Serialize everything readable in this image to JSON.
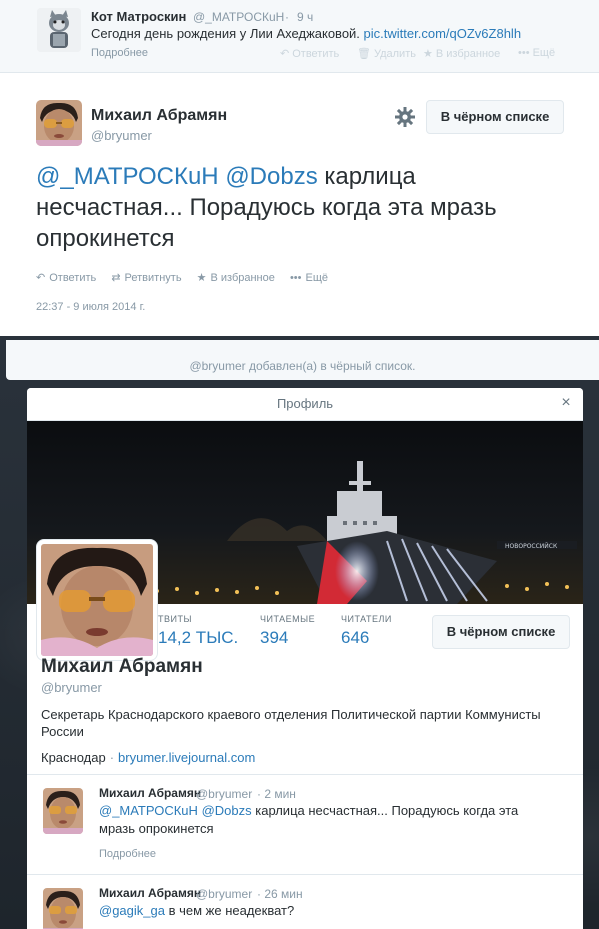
{
  "top_tweet": {
    "name": "Кот Матроскин",
    "handle": "@_МАТРОСКuН",
    "separator": "·",
    "time": "9 ч",
    "text": "Сегодня день рождения у Лии Ахеджаковой.",
    "link": "pic.twitter.com/qOZv6Z8hlh",
    "more": "Подробнее",
    "actions": {
      "reply": "Ответить",
      "delete": "Удалить",
      "favorite": "В избранное",
      "more": "Ещё"
    }
  },
  "main_tweet": {
    "name": "Михаил Абрамян",
    "handle": "@bryumer",
    "blocked_button": "В чёрном списке",
    "mention1": "@_МАТРОСКuН",
    "mention2": "@Dobzs",
    "text": "карлица несчастная... Порадуюсь когда эта мразь опрокинется",
    "actions": {
      "reply": "Ответить",
      "retweet": "Ретвитнуть",
      "favorite": "В избранное",
      "more": "Ещё"
    },
    "timestamp": "22:37 - 9 июля 2014 г."
  },
  "notice": "@bryumer добавлен(а) в чёрный список.",
  "profile": {
    "title": "Профиль",
    "close": "×",
    "stats": [
      {
        "label": "ТВИТЫ",
        "value": "14,2 ТЫС."
      },
      {
        "label": "ЧИТАЕМЫЕ",
        "value": "394"
      },
      {
        "label": "ЧИТАТЕЛИ",
        "value": "646"
      }
    ],
    "blocked_button": "В чёрном списке",
    "name": "Михаил Абрамян",
    "handle": "@bryumer",
    "bio": "Секретарь Краснодарского краевого отделения Политической партии Коммунисты России",
    "location": "Краснодар",
    "dot": "·",
    "url": "bryumer.livejournal.com",
    "banner_sign": "НОВОРОССИЙСК",
    "tweets": [
      {
        "name": "Михаил Абрамян",
        "handle": "@bryumer",
        "time": "· 2 мин",
        "mention1": "@_МАТРОСКuН",
        "mention2": "@Dobzs",
        "text": "карлица несчастная... Порадуюсь когда эта мразь опрокинется",
        "more": "Подробнее"
      },
      {
        "name": "Михаил Абрамян",
        "handle": "@bryumer",
        "time": "· 26 мин",
        "mention1": "@gagik_ga",
        "text": "в чем же неадекват?"
      }
    ]
  }
}
